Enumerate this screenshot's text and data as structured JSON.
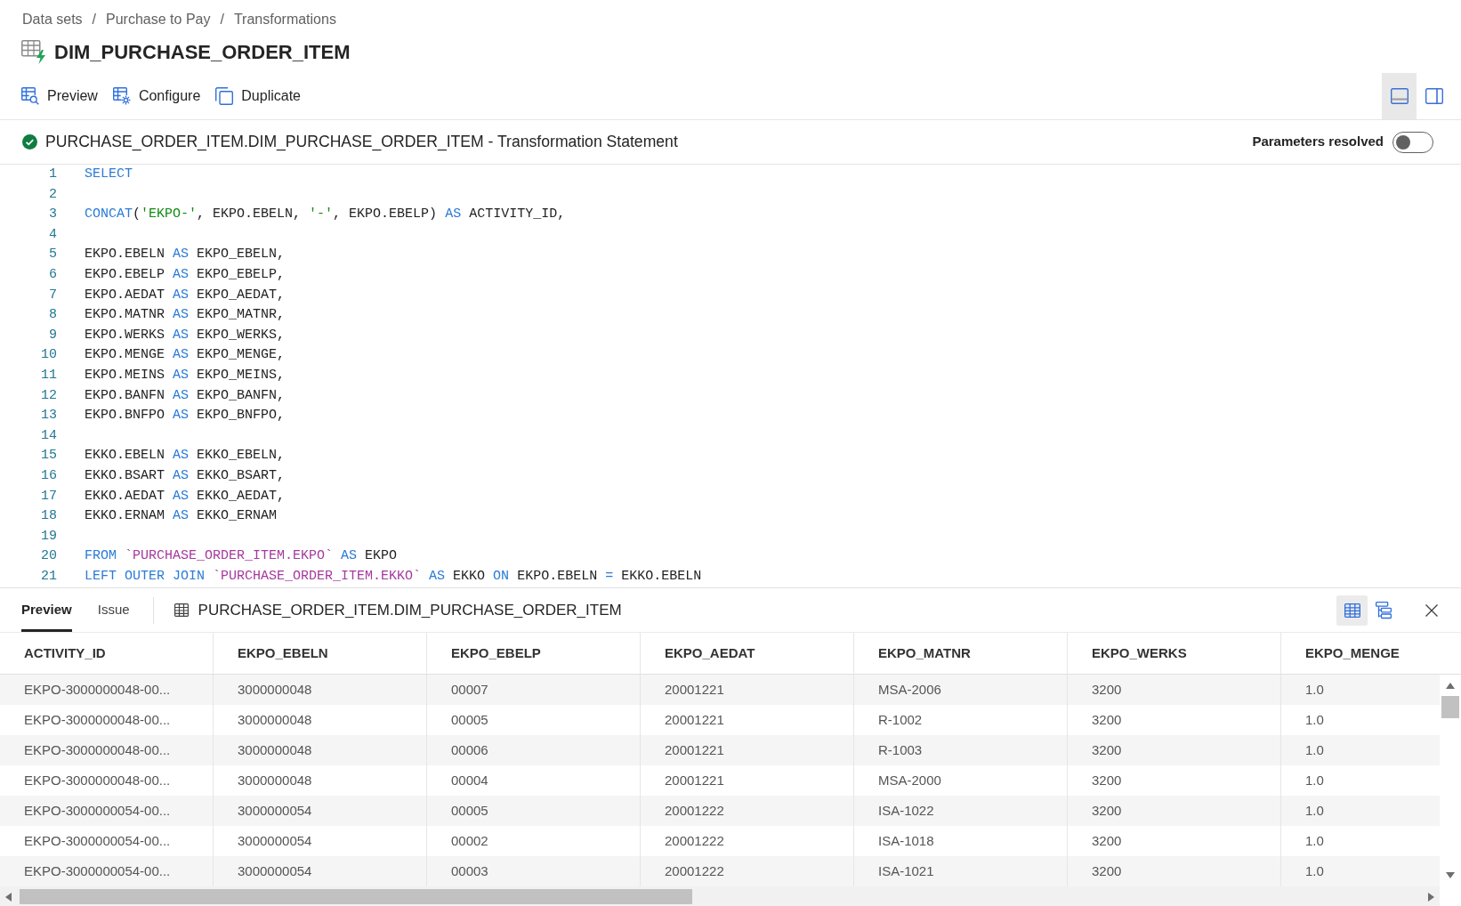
{
  "breadcrumb": [
    {
      "label": "Data sets",
      "separator": "/"
    },
    {
      "label": "Purchase to Pay",
      "separator": "/"
    },
    {
      "label": "Transformations"
    }
  ],
  "title": "DIM_PURCHASE_ORDER_ITEM",
  "toolbar": [
    {
      "kind": "preview",
      "label": "Preview"
    },
    {
      "kind": "configure",
      "label": "Configure"
    },
    {
      "kind": "duplicate",
      "label": "Duplicate"
    }
  ],
  "layout_buttons": [
    {
      "kind": "bottom",
      "selected": true
    },
    {
      "kind": "side",
      "selected": false
    }
  ],
  "statement": {
    "valid": true,
    "title": "PURCHASE_ORDER_ITEM.DIM_PURCHASE_ORDER_ITEM - Transformation Statement",
    "toggle": {
      "label": "Parameters resolved",
      "on": false
    }
  },
  "code_lines": [
    {
      "number": "1",
      "tokens": [
        {
          "kind": "keyword",
          "text": "SELECT"
        }
      ]
    },
    {
      "number": "2"
    },
    {
      "number": "3",
      "tokens": [
        {
          "kind": "keyword",
          "text": "CONCAT"
        },
        {
          "kind": "plain",
          "text": "("
        },
        {
          "kind": "string",
          "text": "'EKPO-'"
        },
        {
          "kind": "plain",
          "text": ", EKPO.EBELN, "
        },
        {
          "kind": "string",
          "text": "'-'"
        },
        {
          "kind": "plain",
          "text": ", EKPO.EBELP) "
        },
        {
          "kind": "keyword",
          "text": "AS"
        },
        {
          "kind": "plain",
          "text": " ACTIVITY_ID,"
        }
      ]
    },
    {
      "number": "4"
    },
    {
      "number": "5",
      "tokens": [
        {
          "kind": "plain",
          "text": "EKPO.EBELN "
        },
        {
          "kind": "keyword",
          "text": "AS"
        },
        {
          "kind": "plain",
          "text": " EKPO_EBELN,"
        }
      ]
    },
    {
      "number": "6",
      "tokens": [
        {
          "kind": "plain",
          "text": "EKPO.EBELP "
        },
        {
          "kind": "keyword",
          "text": "AS"
        },
        {
          "kind": "plain",
          "text": " EKPO_EBELP,"
        }
      ]
    },
    {
      "number": "7",
      "tokens": [
        {
          "kind": "plain",
          "text": "EKPO.AEDAT "
        },
        {
          "kind": "keyword",
          "text": "AS"
        },
        {
          "kind": "plain",
          "text": " EKPO_AEDAT,"
        }
      ]
    },
    {
      "number": "8",
      "tokens": [
        {
          "kind": "plain",
          "text": "EKPO.MATNR "
        },
        {
          "kind": "keyword",
          "text": "AS"
        },
        {
          "kind": "plain",
          "text": " EKPO_MATNR,"
        }
      ]
    },
    {
      "number": "9",
      "tokens": [
        {
          "kind": "plain",
          "text": "EKPO.WERKS "
        },
        {
          "kind": "keyword",
          "text": "AS"
        },
        {
          "kind": "plain",
          "text": " EKPO_WERKS,"
        }
      ]
    },
    {
      "number": "10",
      "tokens": [
        {
          "kind": "plain",
          "text": "EKPO.MENGE "
        },
        {
          "kind": "keyword",
          "text": "AS"
        },
        {
          "kind": "plain",
          "text": " EKPO_MENGE,"
        }
      ]
    },
    {
      "number": "11",
      "tokens": [
        {
          "kind": "plain",
          "text": "EKPO.MEINS "
        },
        {
          "kind": "keyword",
          "text": "AS"
        },
        {
          "kind": "plain",
          "text": " EKPO_MEINS,"
        }
      ]
    },
    {
      "number": "12",
      "tokens": [
        {
          "kind": "plain",
          "text": "EKPO.BANFN "
        },
        {
          "kind": "keyword",
          "text": "AS"
        },
        {
          "kind": "plain",
          "text": " EKPO_BANFN,"
        }
      ]
    },
    {
      "number": "13",
      "tokens": [
        {
          "kind": "plain",
          "text": "EKPO.BNFPO "
        },
        {
          "kind": "keyword",
          "text": "AS"
        },
        {
          "kind": "plain",
          "text": " EKPO_BNFPO,"
        }
      ]
    },
    {
      "number": "14"
    },
    {
      "number": "15",
      "tokens": [
        {
          "kind": "plain",
          "text": "EKKO.EBELN "
        },
        {
          "kind": "keyword",
          "text": "AS"
        },
        {
          "kind": "plain",
          "text": " EKKO_EBELN,"
        }
      ]
    },
    {
      "number": "16",
      "tokens": [
        {
          "kind": "plain",
          "text": "EKKO.BSART "
        },
        {
          "kind": "keyword",
          "text": "AS"
        },
        {
          "kind": "plain",
          "text": " EKKO_BSART,"
        }
      ]
    },
    {
      "number": "17",
      "tokens": [
        {
          "kind": "plain",
          "text": "EKKO.AEDAT "
        },
        {
          "kind": "keyword",
          "text": "AS"
        },
        {
          "kind": "plain",
          "text": " EKKO_AEDAT,"
        }
      ]
    },
    {
      "number": "18",
      "tokens": [
        {
          "kind": "plain",
          "text": "EKKO.ERNAM "
        },
        {
          "kind": "keyword",
          "text": "AS"
        },
        {
          "kind": "plain",
          "text": " EKKO_ERNAM"
        }
      ]
    },
    {
      "number": "19"
    },
    {
      "number": "20",
      "tokens": [
        {
          "kind": "keyword",
          "text": "FROM"
        },
        {
          "kind": "identifier",
          "text": " `PURCHASE_ORDER_ITEM.EKPO` "
        },
        {
          "kind": "keyword",
          "text": "AS"
        },
        {
          "kind": "plain",
          "text": " EKPO"
        }
      ]
    },
    {
      "number": "21",
      "tokens": [
        {
          "kind": "keyword",
          "text": "LEFT OUTER JOIN"
        },
        {
          "kind": "identifier",
          "text": " `PURCHASE_ORDER_ITEM.EKKO` "
        },
        {
          "kind": "keyword",
          "text": "AS"
        },
        {
          "kind": "plain",
          "text": " EKKO "
        },
        {
          "kind": "keyword",
          "text": "ON"
        },
        {
          "kind": "plain",
          "text": " EKPO.EBELN "
        },
        {
          "kind": "keyword",
          "text": "="
        },
        {
          "kind": "plain",
          "text": " EKKO.EBELN"
        }
      ]
    }
  ],
  "preview_panel": {
    "tabs": [
      {
        "label": "Preview",
        "selected": true
      },
      {
        "label": "Issue",
        "selected": false
      }
    ],
    "title": "PURCHASE_ORDER_ITEM.DIM_PURCHASE_ORDER_ITEM",
    "view_buttons": [
      {
        "kind": "table",
        "selected": true
      },
      {
        "kind": "tree",
        "selected": false
      }
    ],
    "table": {
      "columns": [
        "ACTIVITY_ID",
        "EKPO_EBELN",
        "EKPO_EBELP",
        "EKPO_AEDAT",
        "EKPO_MATNR",
        "EKPO_WERKS",
        "EKPO_MENGE"
      ],
      "rows": [
        [
          "EKPO-3000000048-00...",
          "3000000048",
          "00007",
          "20001221",
          "MSA-2006",
          "3200",
          "1.0"
        ],
        [
          "EKPO-3000000048-00...",
          "3000000048",
          "00005",
          "20001221",
          "R-1002",
          "3200",
          "1.0"
        ],
        [
          "EKPO-3000000048-00...",
          "3000000048",
          "00006",
          "20001221",
          "R-1003",
          "3200",
          "1.0"
        ],
        [
          "EKPO-3000000048-00...",
          "3000000048",
          "00004",
          "20001221",
          "MSA-2000",
          "3200",
          "1.0"
        ],
        [
          "EKPO-3000000054-00...",
          "3000000054",
          "00005",
          "20001222",
          "ISA-1022",
          "3200",
          "1.0"
        ],
        [
          "EKPO-3000000054-00...",
          "3000000054",
          "00002",
          "20001222",
          "ISA-1018",
          "3200",
          "1.0"
        ],
        [
          "EKPO-3000000054-00...",
          "3000000054",
          "00003",
          "20001222",
          "ISA-1021",
          "3200",
          "1.0"
        ]
      ]
    }
  }
}
